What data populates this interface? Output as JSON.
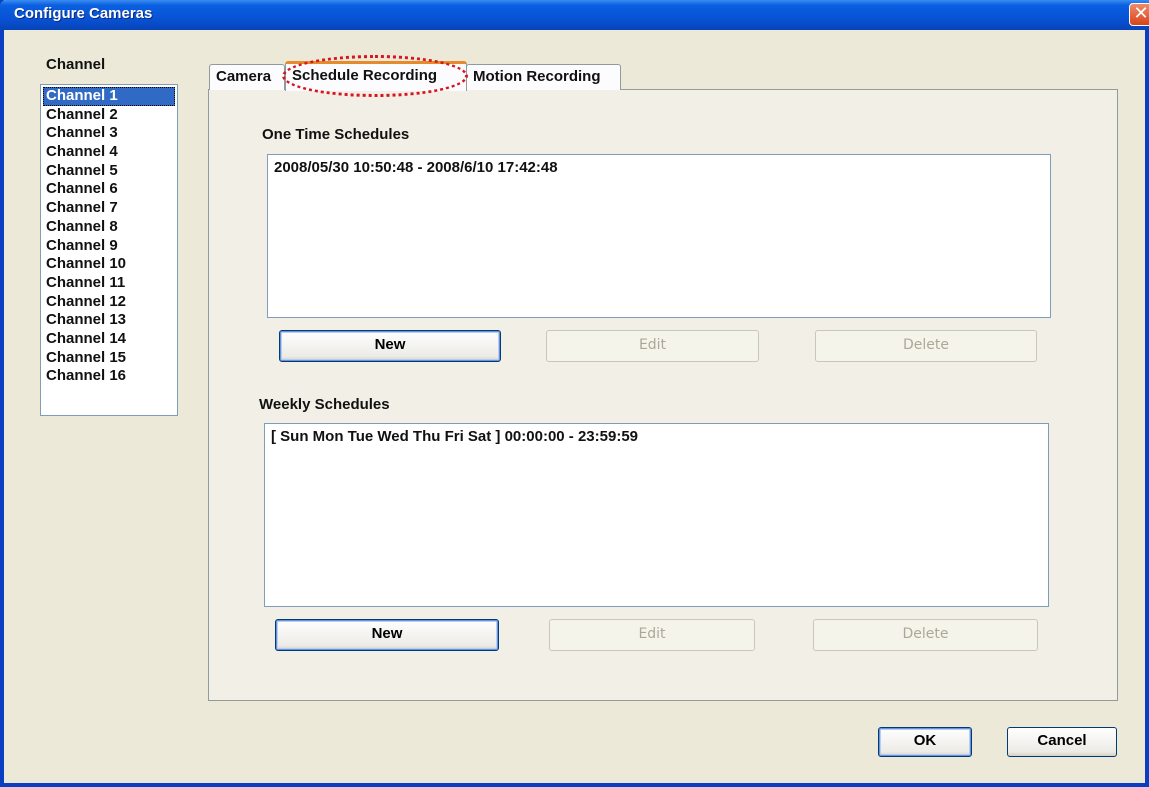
{
  "window": {
    "title": "Configure Cameras",
    "close_label": "✕"
  },
  "channel": {
    "label": "Channel",
    "items": [
      "Channel 1",
      "Channel 2",
      "Channel 3",
      "Channel 4",
      "Channel 5",
      "Channel 6",
      "Channel 7",
      "Channel 8",
      "Channel 9",
      "Channel 10",
      "Channel 11",
      "Channel 12",
      "Channel 13",
      "Channel 14",
      "Channel 15",
      "Channel 16"
    ],
    "selected": "Channel 1"
  },
  "tabs": [
    {
      "label": "Camera"
    },
    {
      "label": "Schedule Recording",
      "active": true
    },
    {
      "label": "Motion Recording"
    }
  ],
  "one_time": {
    "label": "One Time Schedules",
    "entries": [
      "2008/05/30 10:50:48 - 2008/6/10 17:42:48"
    ],
    "new_label": "New",
    "edit_label": "Edit",
    "delete_label": "Delete"
  },
  "weekly": {
    "label": "Weekly Schedules",
    "entries": [
      "[ Sun Mon Tue Wed Thu Fri Sat ] 00:00:00 - 23:59:59"
    ],
    "new_label": "New",
    "edit_label": "Edit",
    "delete_label": "Delete"
  },
  "dialog": {
    "ok_label": "OK",
    "cancel_label": "Cancel"
  },
  "colors": {
    "titlebar": "#0853d6",
    "selection": "#316ac5",
    "highlight_ring": "#d8141c"
  }
}
